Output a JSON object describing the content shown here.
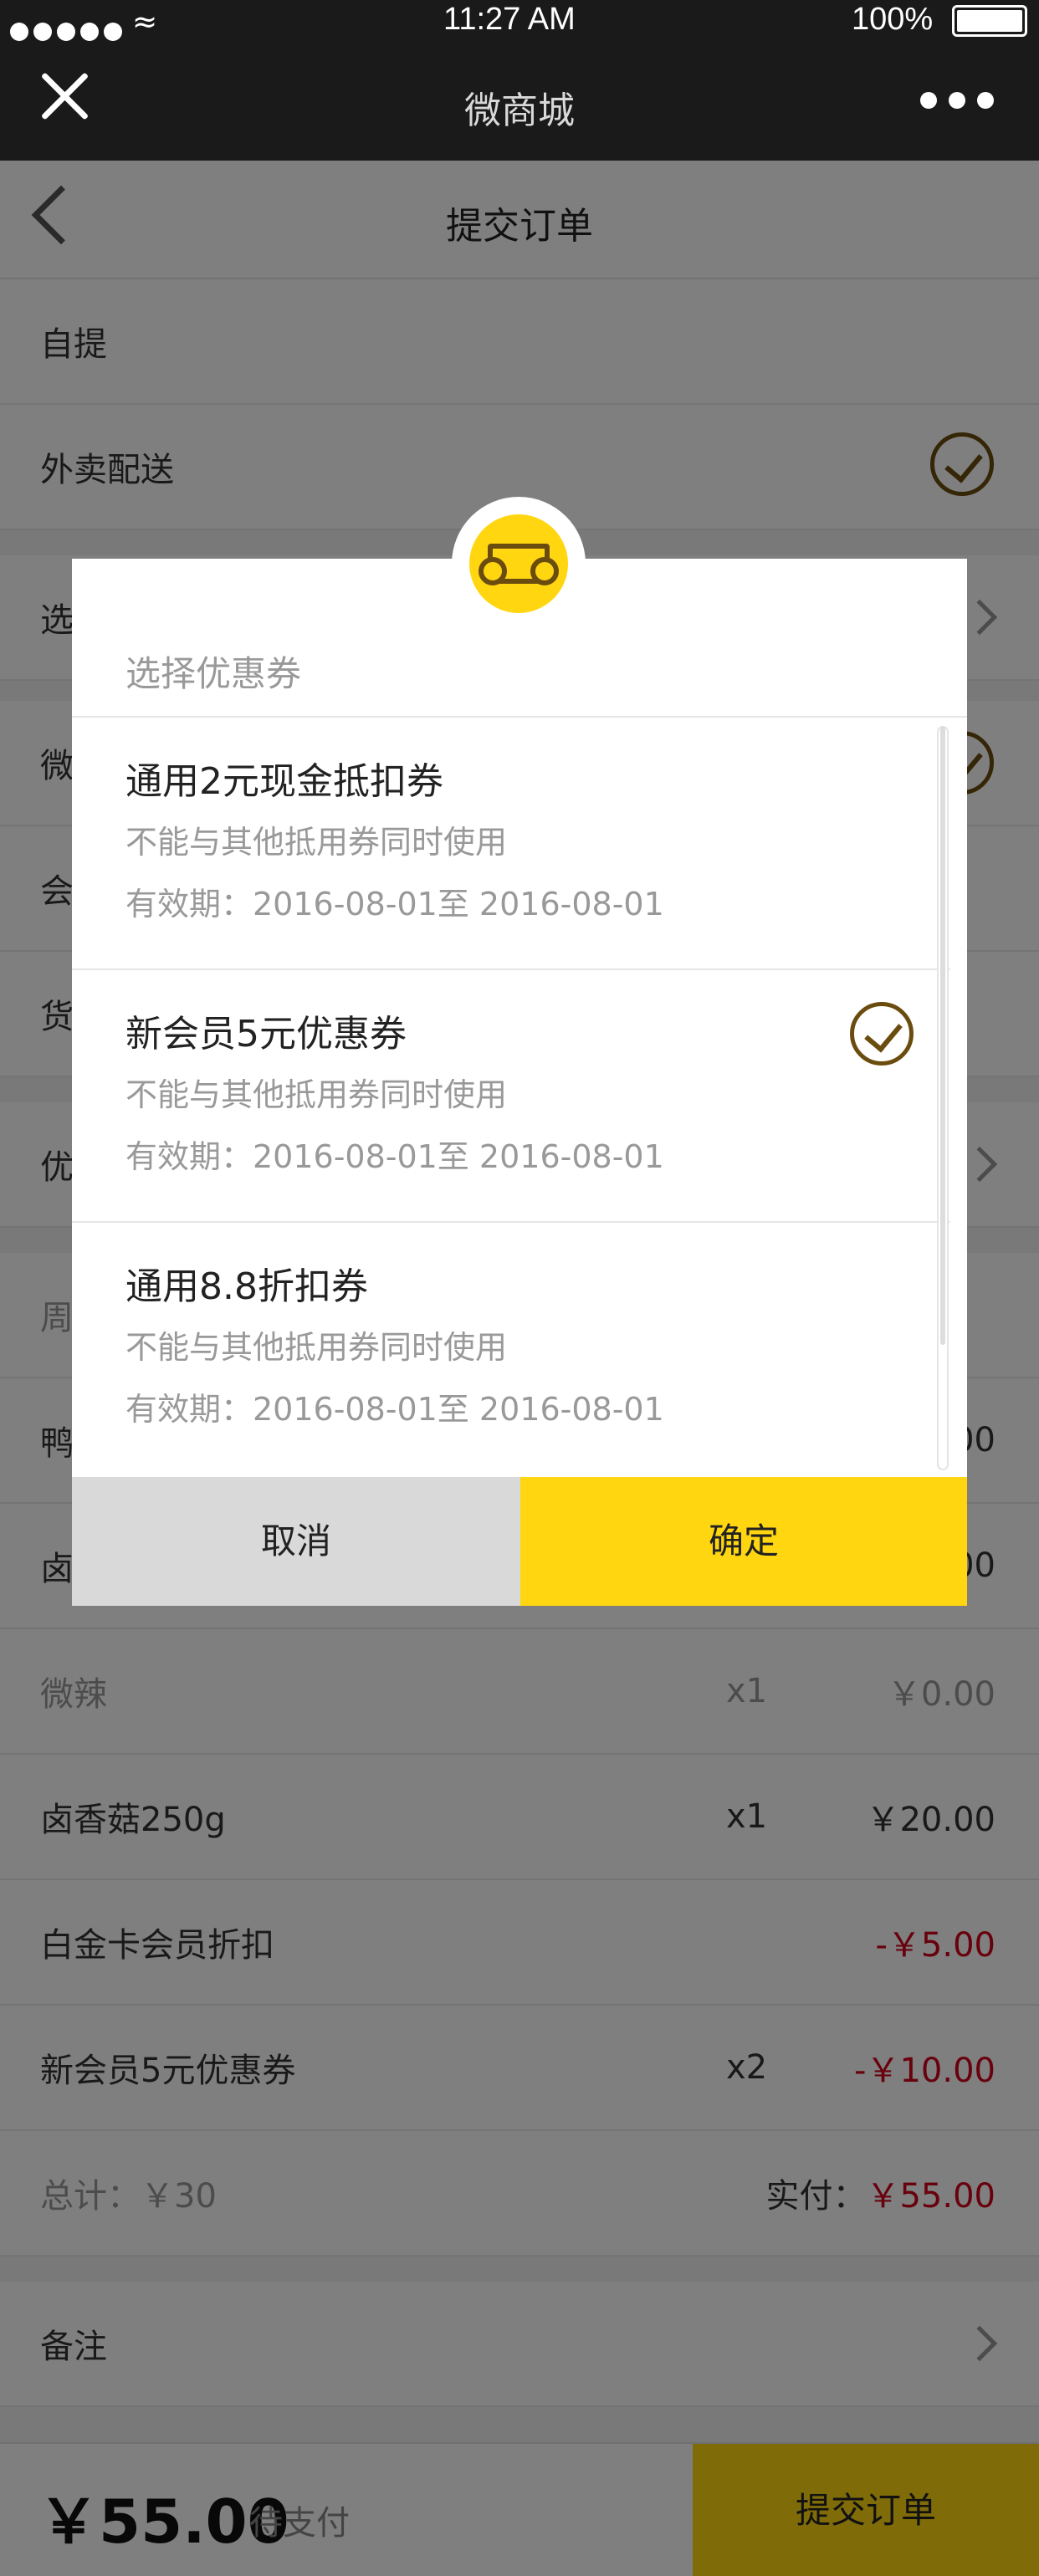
{
  "status_bar": {
    "time": "11:27 AM",
    "battery": "100%"
  },
  "wechat_bar": {
    "title": "微商城"
  },
  "nav": {
    "title": "提交订单"
  },
  "delivery": {
    "self_pickup": "自提",
    "takeout": "外卖配送"
  },
  "rows_behind": {
    "select": "选",
    "wei": "微",
    "hui": "会",
    "huo": "货",
    "you": "优",
    "zhou": "周",
    "ya": "鸭",
    "lu": "卤"
  },
  "row_tails": {
    "ya_tail": "00",
    "lu_tail": "00"
  },
  "items": [
    {
      "name": "微辣",
      "qty": "x1",
      "price": "￥0.00"
    },
    {
      "name": "卤香菇250g",
      "qty": "x1",
      "price": "￥20.00"
    }
  ],
  "discounts": [
    {
      "name": "白金卡会员折扣",
      "qty": "",
      "price": "-￥5.00"
    },
    {
      "name": "新会员5元优惠券",
      "qty": "x2",
      "price": "-￥10.00"
    }
  ],
  "totals": {
    "total_label": "总计：￥30",
    "paid_label": "实付：",
    "paid_value": "￥55.00"
  },
  "remark": {
    "label": "备注"
  },
  "bottom_bar": {
    "amount": "￥55.00",
    "status": "待支付",
    "submit": "提交订单"
  },
  "dialog": {
    "title": "选择优惠券",
    "coupons": [
      {
        "name": "通用2元现金抵扣券",
        "desc": "不能与其他抵用券同时使用",
        "valid": "有效期：2016-08-01至 2016-08-01",
        "selected": false
      },
      {
        "name": "新会员5元优惠券",
        "desc": "不能与其他抵用券同时使用",
        "valid": "有效期：2016-08-01至 2016-08-01",
        "selected": true
      },
      {
        "name": "通用8.8折扣券",
        "desc": "不能与其他抵用券同时使用",
        "valid": "有效期：2016-08-01至 2016-08-01",
        "selected": false
      }
    ],
    "cancel": "取消",
    "confirm": "确定"
  },
  "colors": {
    "accent": "#ffd610",
    "check": "#6b4c0f",
    "price_red": "#d0021b"
  }
}
